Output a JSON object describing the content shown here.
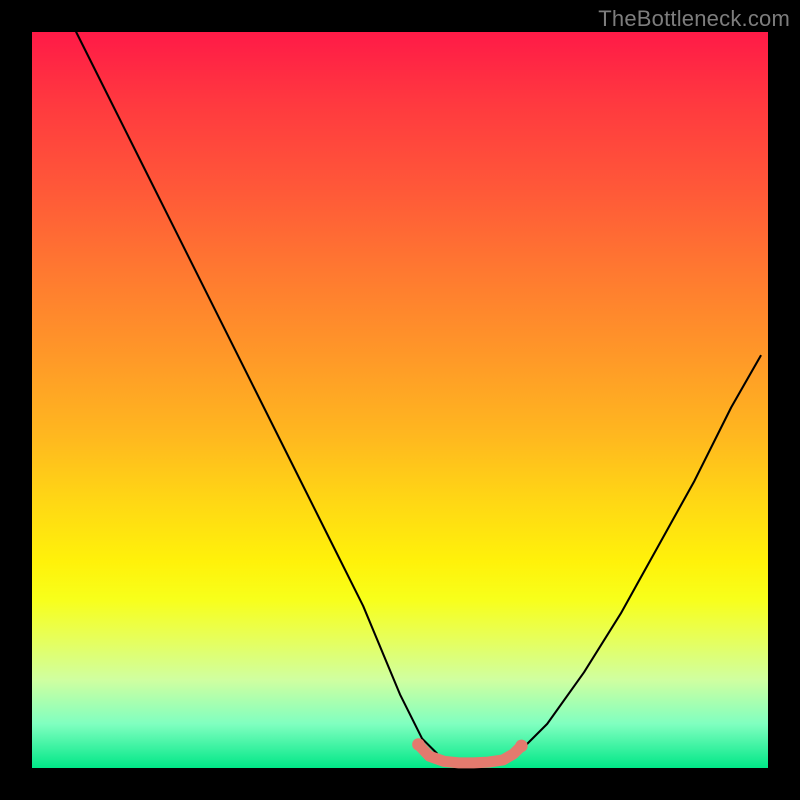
{
  "watermark": "TheBottleneck.com",
  "chart_data": {
    "type": "line",
    "title": "",
    "xlabel": "",
    "ylabel": "",
    "xlim": [
      0,
      100
    ],
    "ylim": [
      0,
      100
    ],
    "grid": false,
    "legend": false,
    "series": [
      {
        "name": "left-curve",
        "color": "#000000",
        "x": [
          6,
          10,
          15,
          20,
          25,
          30,
          35,
          40,
          45,
          50,
          53,
          55
        ],
        "y": [
          100,
          92,
          82,
          72,
          62,
          52,
          42,
          32,
          22,
          10,
          4,
          2
        ]
      },
      {
        "name": "right-curve",
        "color": "#000000",
        "x": [
          66,
          70,
          75,
          80,
          85,
          90,
          95,
          99
        ],
        "y": [
          2,
          6,
          13,
          21,
          30,
          39,
          49,
          56
        ]
      },
      {
        "name": "valley-highlight",
        "color": "#e47a6e",
        "x": [
          52.5,
          54,
          56,
          58,
          60,
          62,
          64,
          65.4,
          66.5
        ],
        "y": [
          3.2,
          1.6,
          0.9,
          0.7,
          0.7,
          0.8,
          1.1,
          1.9,
          3.0
        ]
      }
    ],
    "markers": [
      {
        "name": "left-dot",
        "color": "#e47a6e",
        "x": 52.5,
        "y": 3.2,
        "r": 0.85
      },
      {
        "name": "right-dot",
        "color": "#e47a6e",
        "x": 66.5,
        "y": 3.0,
        "r": 0.85
      }
    ]
  }
}
